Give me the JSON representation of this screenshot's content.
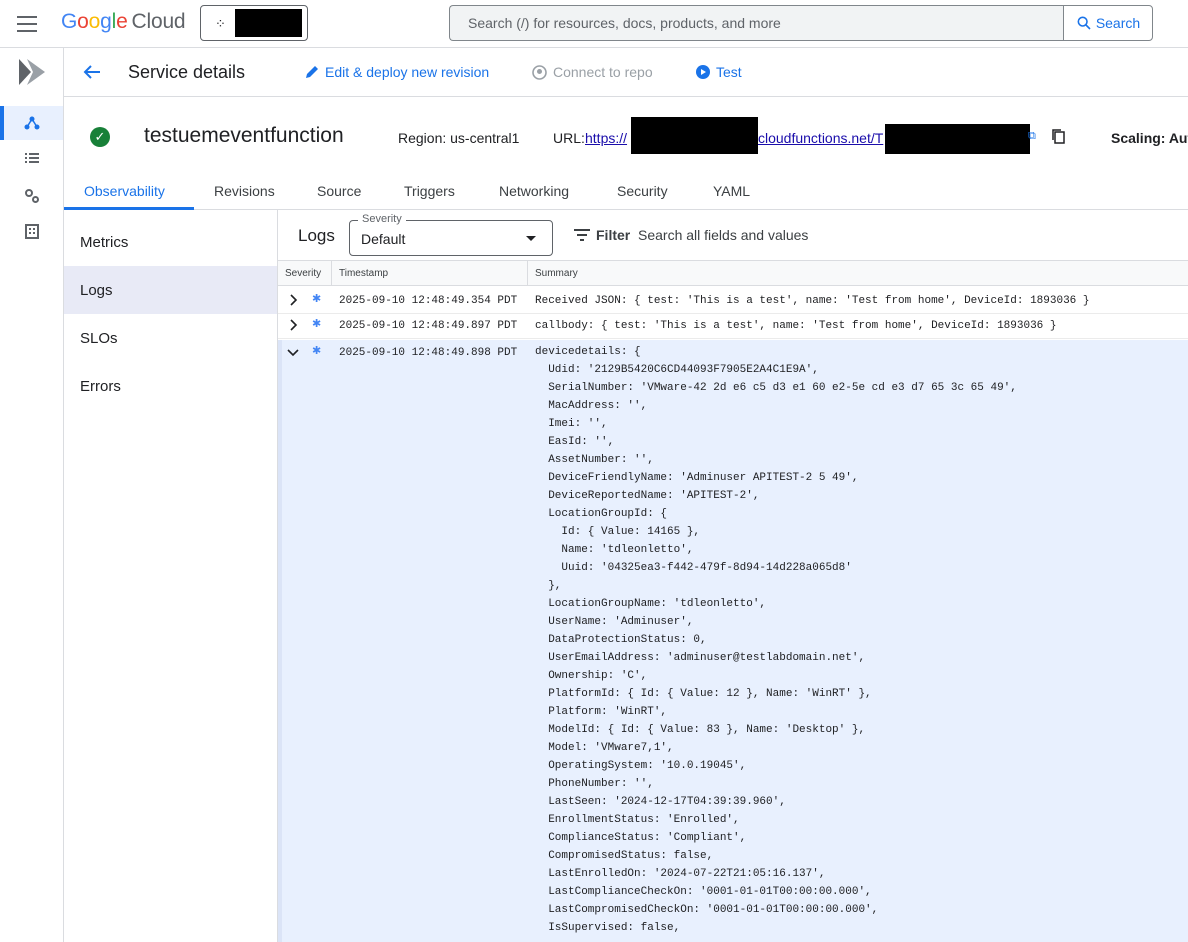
{
  "topbar": {
    "logo_parts": [
      "G",
      "o",
      "o",
      "g",
      "l",
      "e"
    ],
    "logo_suffix": "Cloud",
    "search_placeholder": "Search (/) for resources, docs, products, and more",
    "search_button": "Search"
  },
  "header": {
    "title": "Service details",
    "edit_deploy": "Edit & deploy new revision",
    "connect_repo": "Connect to repo",
    "test": "Test"
  },
  "service": {
    "name": "testuemeventfunction",
    "region": "Region: us-central1",
    "url_label": "URL:",
    "url_part1": "https://",
    "url_part2": "cloudfunctions.net/T",
    "scaling": "Scaling: Auto"
  },
  "tabs": [
    "Observability",
    "Revisions",
    "Source",
    "Triggers",
    "Networking",
    "Security",
    "YAML"
  ],
  "subnav": [
    "Metrics",
    "Logs",
    "SLOs",
    "Errors"
  ],
  "logs": {
    "title": "Logs",
    "severity_label": "Severity",
    "severity_value": "Default",
    "filter_label": "Filter",
    "filter_placeholder": "Search all fields and values",
    "columns": [
      "Severity",
      "Timestamp",
      "Summary"
    ],
    "rows": [
      {
        "ts": "2025-09-10 12:48:49.354 PDT",
        "msg": "Received JSON: { test: 'This is a test', name: 'Test from home', DeviceId: 1893036 }"
      },
      {
        "ts": "2025-09-10 12:48:49.897 PDT",
        "msg": "callbody: { test: 'This is a test', name: 'Test from home', DeviceId: 1893036 }"
      }
    ],
    "expanded": {
      "ts": "2025-09-10 12:48:49.898 PDT",
      "lines": [
        "devicedetails: {",
        "  Udid: '2129B5420C6CD44093F7905E2A4C1E9A',",
        "  SerialNumber: 'VMware-42 2d e6 c5 d3 e1 60 e2-5e cd e3 d7 65 3c 65 49',",
        "  MacAddress: '',",
        "  Imei: '',",
        "  EasId: '',",
        "  AssetNumber: '',",
        "  DeviceFriendlyName: 'Adminuser APITEST-2 5 49',",
        "  DeviceReportedName: 'APITEST-2',",
        "  LocationGroupId: {",
        "    Id: { Value: 14165 },",
        "    Name: 'tdleonletto',",
        "    Uuid: '04325ea3-f442-479f-8d94-14d228a065d8'",
        "  },",
        "  LocationGroupName: 'tdleonletto',",
        "  UserName: 'Adminuser',",
        "  DataProtectionStatus: 0,",
        "  UserEmailAddress: 'adminuser@testlabdomain.net',",
        "  Ownership: 'C',",
        "  PlatformId: { Id: { Value: 12 }, Name: 'WinRT' },",
        "  Platform: 'WinRT',",
        "  ModelId: { Id: { Value: 83 }, Name: 'Desktop' },",
        "  Model: 'VMware7,1',",
        "  OperatingSystem: '10.0.19045',",
        "  PhoneNumber: '',",
        "  LastSeen: '2024-12-17T04:39:39.960',",
        "  EnrollmentStatus: 'Enrolled',",
        "  ComplianceStatus: 'Compliant',",
        "  CompromisedStatus: false,",
        "  LastEnrolledOn: '2024-07-22T21:05:16.137',",
        "  LastComplianceCheckOn: '0001-01-01T00:00:00.000',",
        "  LastCompromisedCheckOn: '0001-01-01T00:00:00.000',",
        "  IsSupervised: false,"
      ]
    }
  }
}
